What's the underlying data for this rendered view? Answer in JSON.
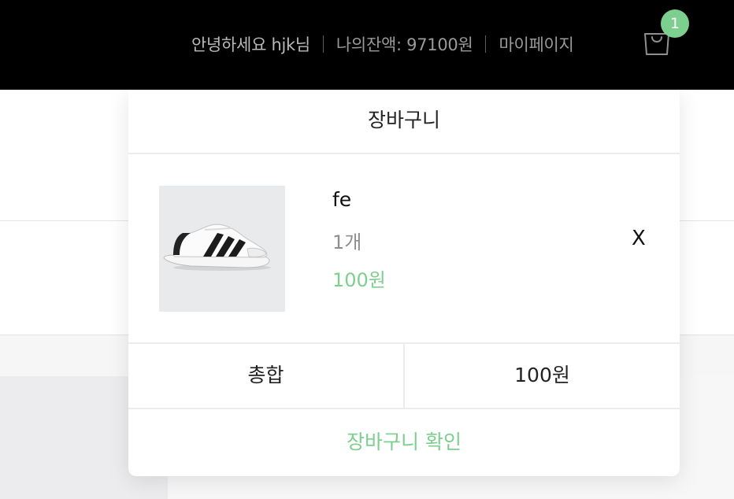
{
  "header": {
    "greeting": "안녕하세요 hjk님",
    "balance": "나의잔액: 97100원",
    "mypage_label": "마이페이지",
    "cart_icon": "shopping-bag-icon",
    "cart_count": "1"
  },
  "cart": {
    "title": "장바구니",
    "items": [
      {
        "image": "sneaker-product-image",
        "name": "fe",
        "quantity": "1개",
        "price": "100원",
        "remove_label": "X"
      }
    ],
    "total_label": "총합",
    "total_value": "100원",
    "confirm_label": "장바구니 확인"
  },
  "colors": {
    "accent": "#7ccf8f",
    "header_bg": "#000000"
  }
}
